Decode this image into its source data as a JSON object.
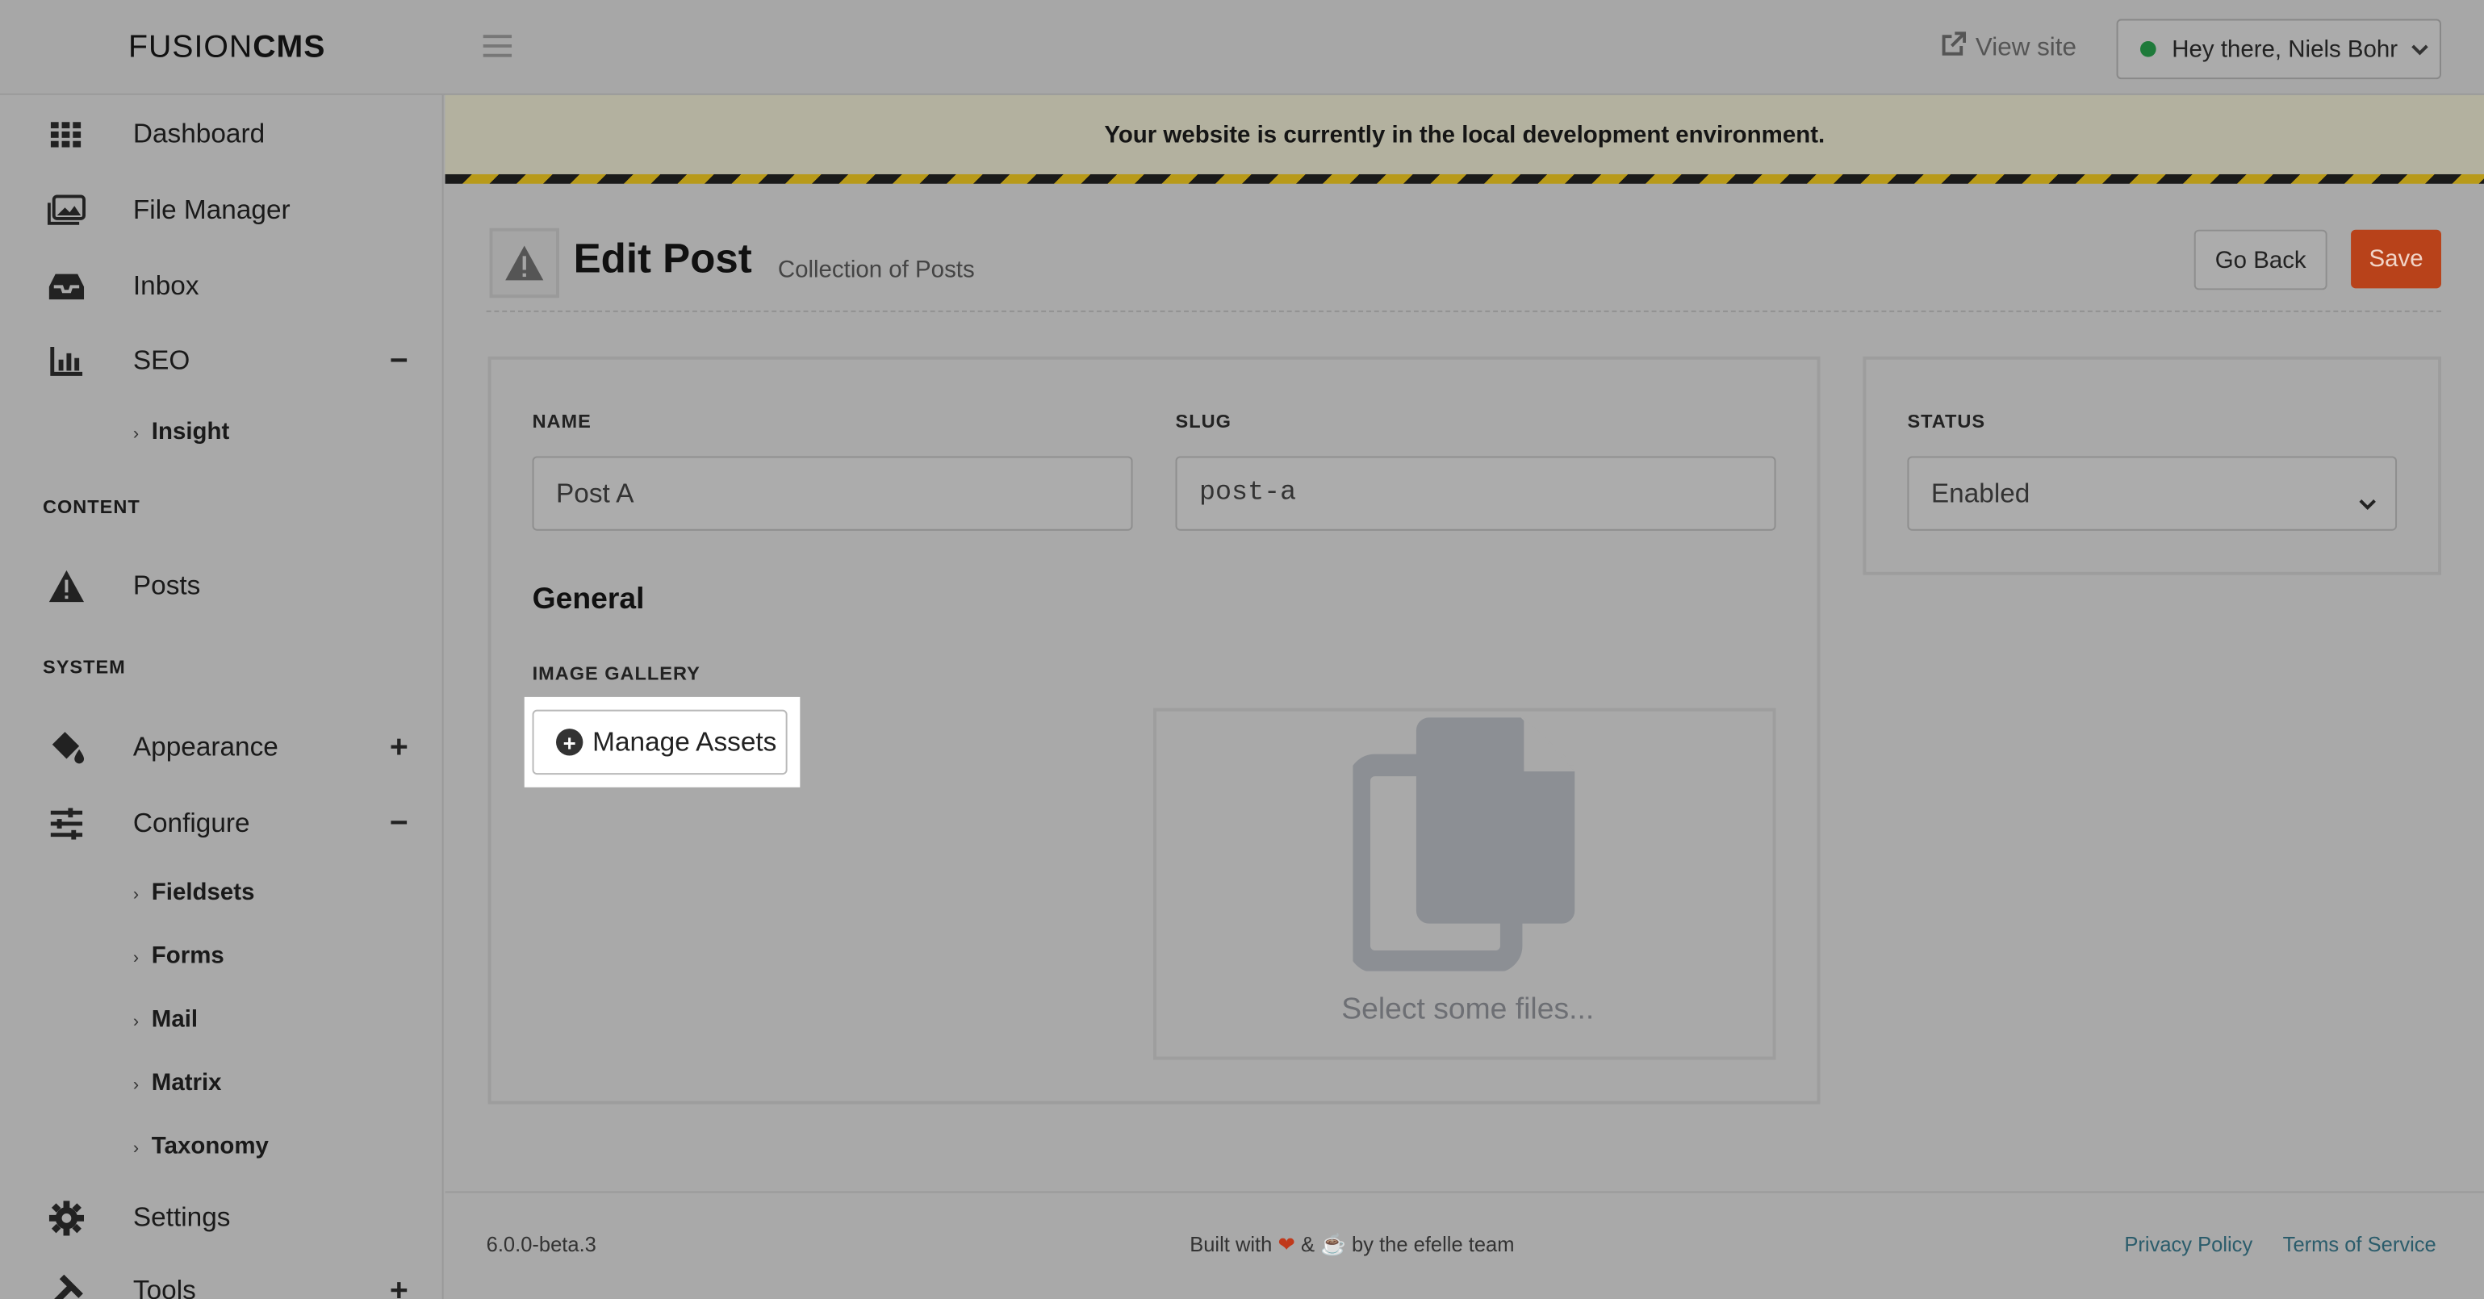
{
  "app": {
    "logo_regular": "FUSION",
    "logo_bold": "CMS"
  },
  "topbar": {
    "view_site_label": "View site",
    "user_greeting": "Hey there, Niels Bohr"
  },
  "sidebar": {
    "items": [
      {
        "label": "Dashboard",
        "icon": "grid-icon"
      },
      {
        "label": "File Manager",
        "icon": "images-icon"
      },
      {
        "label": "Inbox",
        "icon": "inbox-icon"
      },
      {
        "label": "SEO",
        "icon": "chart-bar-icon",
        "toggle": "−"
      }
    ],
    "seo_sub": [
      "Insight"
    ],
    "content_header": "CONTENT",
    "posts_label": "Posts",
    "system_header": "SYSTEM",
    "appearance_label": "Appearance",
    "appearance_toggle": "+",
    "configure_label": "Configure",
    "configure_toggle": "−",
    "configure_sub": [
      "Fieldsets",
      "Forms",
      "Mail",
      "Matrix",
      "Taxonomy"
    ],
    "settings_label": "Settings",
    "tools_label": "Tools",
    "tools_toggle": "+"
  },
  "banner": {
    "text": "Your website is currently in the local development environment."
  },
  "page": {
    "title": "Edit Post",
    "subtitle": "Collection of Posts",
    "go_back_label": "Go Back",
    "save_label": "Save"
  },
  "form": {
    "name_label": "NAME",
    "name_value": "Post A",
    "slug_label": "SLUG",
    "slug_value": "post-a",
    "general_heading": "General",
    "gallery_label": "IMAGE GALLERY",
    "manage_assets_label": "Manage Assets",
    "dropzone_text": "Select some files..."
  },
  "status": {
    "label": "STATUS",
    "value": "Enabled"
  },
  "footer": {
    "version": "6.0.0-beta.3",
    "built_prefix": "Built with",
    "built_and": "&",
    "built_suffix": "by the efelle team",
    "privacy": "Privacy Policy",
    "terms": "Terms of Service"
  }
}
